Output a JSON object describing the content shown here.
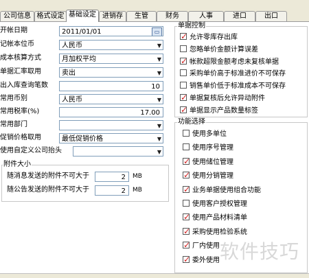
{
  "tabs": [
    "公司信息",
    "格式设定",
    "基础设定",
    "进销存",
    "生管",
    "财务",
    "人事",
    "进口",
    "出口"
  ],
  "active_tab": "基础设定",
  "form": {
    "open_date_label": "开帐日期",
    "open_date_value": "2011/01/01",
    "currency_label": "记帐本位币",
    "currency_value": "人民币",
    "cost_method_label": "成本核算方式",
    "cost_method_value": "月加权平均",
    "doc_rate_label": "单据汇率取用",
    "doc_rate_value": "卖出",
    "io_query_label": "出入库查询笔数",
    "io_query_value": "10",
    "common_currency_label": "常用币别",
    "common_currency_value": "人民币",
    "common_tax_label": "常用税率(%)",
    "common_tax_value": "17.00",
    "common_dept_label": "常用部门",
    "common_dept_value": "",
    "promo_price_label": "促销价格取用",
    "promo_price_value": "最低促销价格",
    "custom_header_label": "使用自定义公司抬头",
    "custom_header_value": ""
  },
  "attachment": {
    "title": "附件大小",
    "msg_label": "随消息发送的附件不可大于",
    "msg_value": "2",
    "notice_label": "随公告发送的附件不可大于",
    "notice_value": "2",
    "unit": "MB"
  },
  "doc_control": {
    "title": "单据控制",
    "items": [
      {
        "label": "允许零库存出库",
        "checked": true
      },
      {
        "label": "忽略单价金额计算误差",
        "checked": false
      },
      {
        "label": "帐款超限金额考虑未复核单据",
        "checked": true
      },
      {
        "label": "采购单价高于标准进价不可保存",
        "checked": false
      },
      {
        "label": "销售单价低于标准成本不可保存",
        "checked": false
      },
      {
        "label": "单据复核后允许异动附件",
        "checked": true
      },
      {
        "label": "单据显示产品数量标签",
        "checked": true
      }
    ]
  },
  "features": {
    "title": "功能选择",
    "items": [
      {
        "label": "使用多单位",
        "checked": false
      },
      {
        "label": "使用序号管理",
        "checked": false
      },
      {
        "label": "使用储位管理",
        "checked": true
      },
      {
        "label": "使用分销管理",
        "checked": true
      },
      {
        "label": "业务单据使用组合功能",
        "checked": true
      },
      {
        "label": "使用客户授权管理",
        "checked": false
      },
      {
        "label": "使用产品材料清单",
        "checked": true
      },
      {
        "label": "采购使用检验系统",
        "checked": true
      },
      {
        "label": "厂内使用",
        "checked": true
      },
      {
        "label": "委外使用",
        "checked": true
      }
    ]
  },
  "icons": {
    "dropdown": "chevron-down-icon",
    "calendar": "calendar-icon",
    "checkbox": "checkbox-icon"
  },
  "watermark": "软件技巧"
}
